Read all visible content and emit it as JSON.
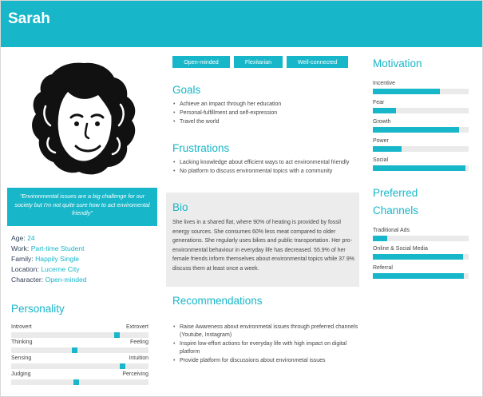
{
  "persona": {
    "name": "Sarah"
  },
  "quote": "\"Environmental issues are a big challenge for our society but I'm not quite sure how to act enviromental friendly\"",
  "facts": [
    {
      "key": "Age:",
      "value": "24"
    },
    {
      "key": "Work:",
      "value": "Part-time Student"
    },
    {
      "key": "Family:",
      "value": "Happily Single"
    },
    {
      "key": "Location:",
      "value": "Lucerne City"
    },
    {
      "key": "Character:",
      "value": "Open-minded"
    }
  ],
  "personality": {
    "title": "Personality",
    "traits": [
      {
        "left": "Introvert",
        "right": "Extrovert",
        "level": 0.77
      },
      {
        "left": "Thinking",
        "right": "Feeling",
        "level": 0.46
      },
      {
        "left": "Sensing",
        "right": "Intuition",
        "level": 0.81
      },
      {
        "left": "Judging",
        "right": "Perceiving",
        "level": 0.47
      }
    ]
  },
  "tags": [
    "Open-minded",
    "Flexitarian",
    "Well-connected"
  ],
  "goals": {
    "title": "Goals",
    "items": [
      "Achieve an impact through her education",
      "Personal-fulfillment and self-expression",
      "Travel the world"
    ]
  },
  "frustrations": {
    "title": "Frustrations",
    "items": [
      "Lacking knowledge about efficient ways to act environmental friendly",
      "No platform to discuss environmental topics with a community"
    ]
  },
  "bio": {
    "title": "Bio",
    "text": "She lives in a shared flat, where 90% of heating is provided by fossil energy sources. She consumes 60% less meat compared to older generations. She regularly uses bikes and public transportation. Her pro-environmental behaviour in everyday life has decreased. 55.9% of her female friends inform themselves about environmental topics while 37.9% discuss them at least once a week."
  },
  "recommendations": {
    "title": "Recommendations",
    "items": [
      "Raise Awareness about environmetal issues through preferred channels (Youtube, Instagram)",
      "Inspire low-effort actions for everyday life with high impact on digital platform",
      "Provide platform for discussions about environmetal issues"
    ]
  },
  "motivation": {
    "title": "Motivation",
    "bars": [
      {
        "label": "Incentive",
        "level": 0.7
      },
      {
        "label": "Fear",
        "level": 0.24
      },
      {
        "label": "Growth",
        "level": 0.9
      },
      {
        "label": "Power",
        "level": 0.3
      },
      {
        "label": "Social",
        "level": 0.97
      }
    ]
  },
  "channels": {
    "title_line1": "Preferred",
    "title_line2": "Channels",
    "bars": [
      {
        "label": "Traditional Ads",
        "level": 0.15
      },
      {
        "label": "Online & Social Media",
        "level": 0.94
      },
      {
        "label": "Referral",
        "level": 0.95
      }
    ]
  },
  "colors": {
    "accent": "#17b6c9",
    "track": "#eaeaea",
    "bio_background": "#ececec"
  },
  "icons": {
    "avatar": "woman-curly-hair-illustration"
  }
}
